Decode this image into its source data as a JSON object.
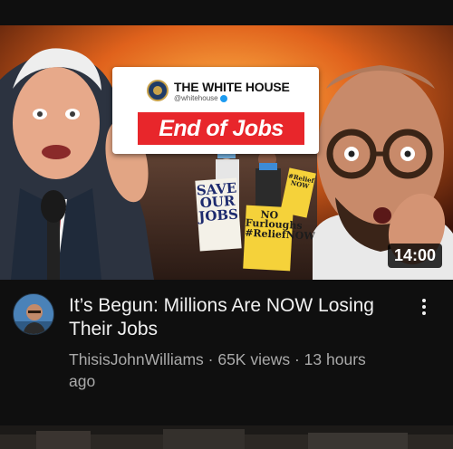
{
  "video": {
    "duration": "14:00",
    "title": "It’s Begun: Millions Are NOW Losing Their Jobs",
    "channel": "ThisisJohnWilliams",
    "separator": " · ",
    "views": "65K views",
    "age": "13 hours ago"
  },
  "thumbnail": {
    "tweet_name": "THE WHITE HOUSE",
    "tweet_handle": "@whitehouse",
    "banner_text": "End of Jobs",
    "sign_save": "SAVE OUR JOBS",
    "sign_no": "NO Furloughs #ReliefNOW",
    "sign_relief": "#Relief NOW"
  },
  "icons": {
    "menu": "more-vertical-icon",
    "verified": "verified-badge-icon"
  },
  "colors": {
    "background": "#0f0f0f",
    "title_text": "#f1f1f1",
    "secondary_text": "#aaaaaa",
    "banner_red": "#e8262b",
    "duration_bg": "#000000"
  }
}
